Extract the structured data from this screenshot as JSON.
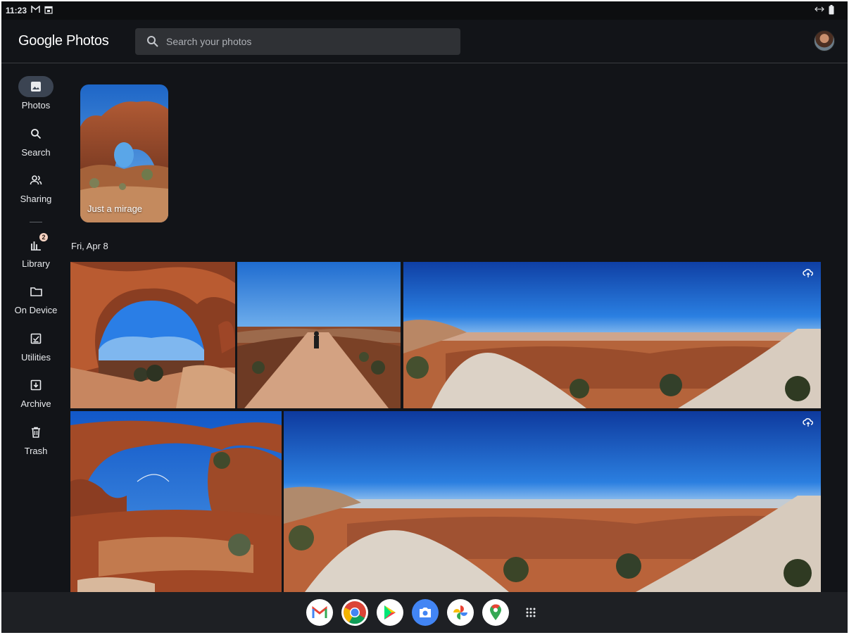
{
  "status_bar": {
    "time": "11:23",
    "icons": [
      "gmail-notification-icon",
      "calendar-notification-icon",
      "swap-icon",
      "battery-icon"
    ]
  },
  "app": {
    "title": "Google Photos",
    "search_placeholder": "Search your photos"
  },
  "sidebar": {
    "items": [
      {
        "label": "Photos",
        "icon": "photo-icon",
        "active": true
      },
      {
        "label": "Search",
        "icon": "search-icon"
      },
      {
        "label": "Sharing",
        "icon": "people-icon"
      },
      {
        "label": "Library",
        "icon": "library-icon",
        "badge": "2"
      },
      {
        "label": "On Device",
        "icon": "folder-icon"
      },
      {
        "label": "Utilities",
        "icon": "checklist-icon"
      },
      {
        "label": "Archive",
        "icon": "archive-icon"
      },
      {
        "label": "Trash",
        "icon": "trash-icon"
      }
    ]
  },
  "memory": {
    "title": "Just a mirage"
  },
  "timeline": {
    "date_header": "Fri, Apr 8"
  },
  "shelf": {
    "apps": [
      "gmail-app-icon",
      "chrome-app-icon",
      "play-store-app-icon",
      "camera-app-icon",
      "photos-app-icon",
      "maps-app-icon",
      "launcher-icon"
    ]
  },
  "colors": {
    "background": "#121418",
    "active_nav": "#3b4452",
    "shelf": "#1e2024"
  }
}
